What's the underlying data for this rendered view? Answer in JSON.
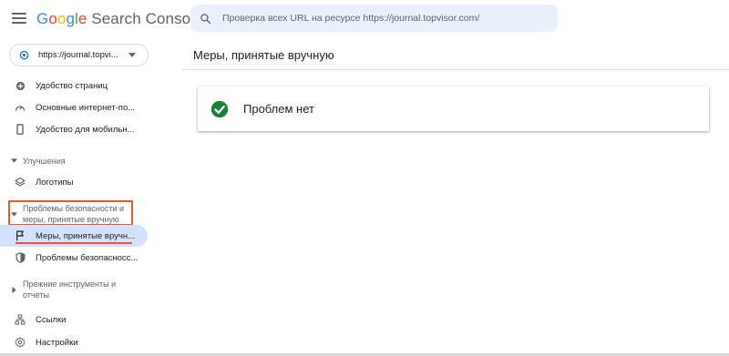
{
  "header": {
    "logo_word": "Google",
    "logo_rest": "Search Console",
    "search_placeholder": "Проверка всех URL на ресурсе https://journal.topvisor.com/"
  },
  "property": {
    "label": "https://journal.topvi..."
  },
  "sidebar": {
    "items_top": [
      {
        "label": "Удобство страниц",
        "icon": "page-experience-icon"
      },
      {
        "label": "Основные интернет-по...",
        "icon": "core-web-vitals-icon"
      },
      {
        "label": "Удобство для мобильн...",
        "icon": "mobile-icon"
      }
    ],
    "enhancements_section": "Улучшения",
    "logos_item": "Логотипы",
    "security_section": "Проблемы безопасности и меры, принятые вручную",
    "manual_actions_item": "Меры, принятые вручн...",
    "security_issues_item": "Проблемы безопасносс...",
    "legacy_section": "Прежние инструменты и отчеты",
    "links_item": "Ссылки",
    "settings_item": "Настройки"
  },
  "main": {
    "title": "Меры, принятые вручную",
    "status_text": "Проблем нет"
  },
  "colors": {
    "accent": "#1a73e8",
    "active_bg": "#d3e3fd",
    "search_bg": "#eaf1fb",
    "success": "#188038",
    "annotation": "#e8582a"
  }
}
